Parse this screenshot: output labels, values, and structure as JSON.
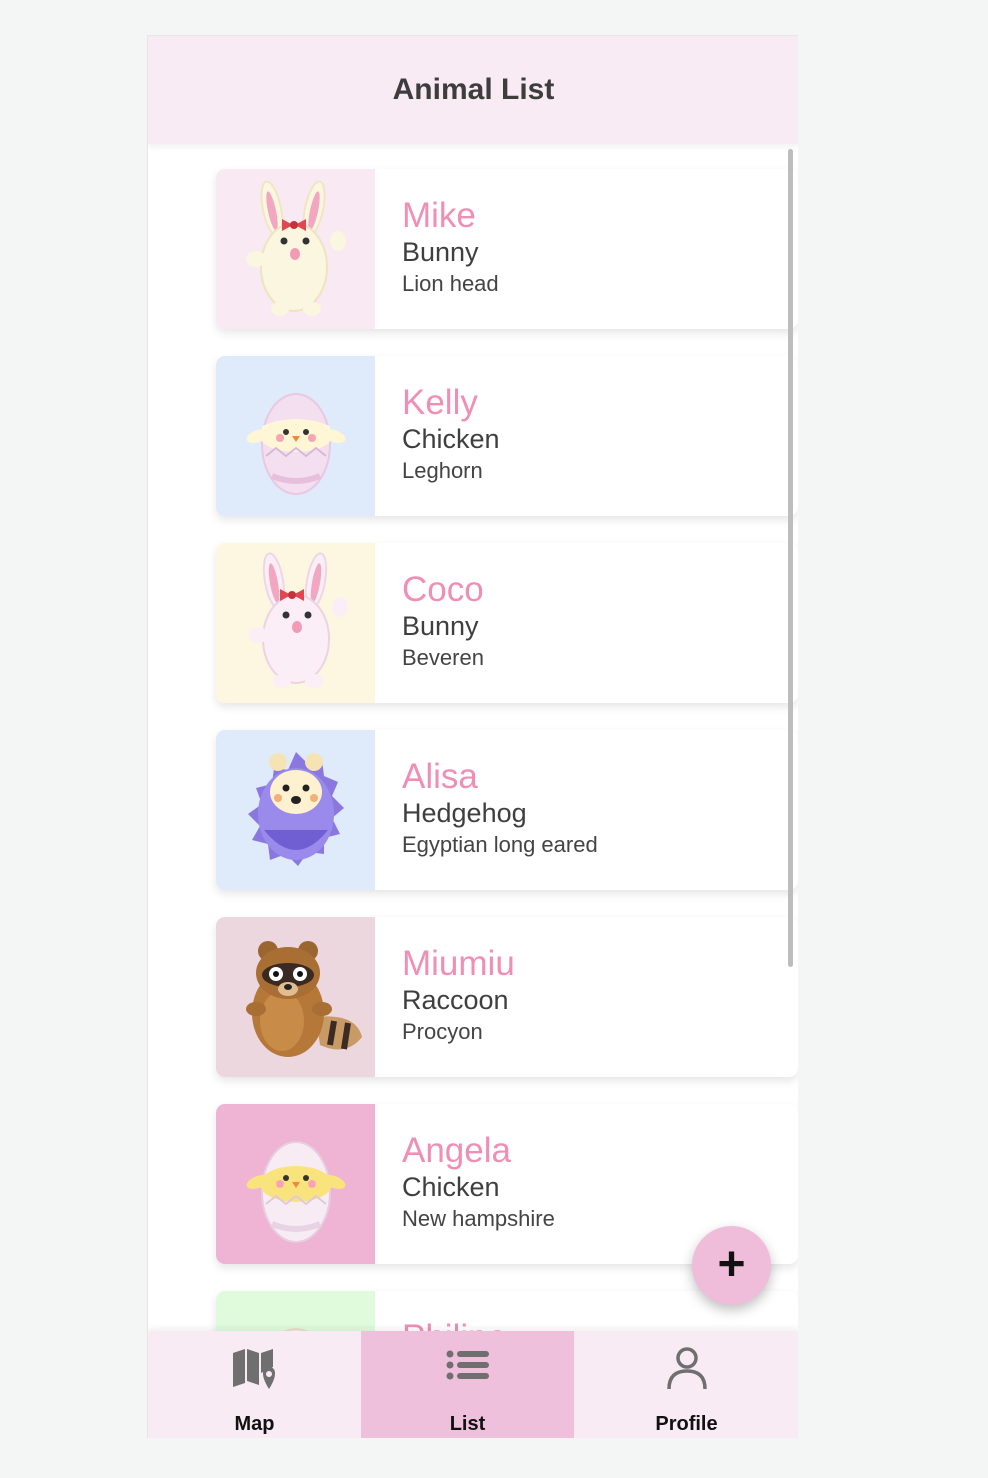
{
  "header": {
    "title": "Animal List"
  },
  "animals": [
    {
      "name": "Mike",
      "species": "Bunny",
      "breed": "Lion head",
      "bg": "#f8e9f3",
      "icon": "bunny-icon"
    },
    {
      "name": "Kelly",
      "species": "Chicken",
      "breed": "Leghorn",
      "bg": "#dfeafb",
      "icon": "chick-in-egg-icon"
    },
    {
      "name": "Coco",
      "species": "Bunny",
      "breed": "Beveren",
      "bg": "#fdf7e1",
      "icon": "bunny-icon"
    },
    {
      "name": "Alisa",
      "species": "Hedgehog",
      "breed": "Egyptian long eared",
      "bg": "#dfeafb",
      "icon": "hedgehog-icon"
    },
    {
      "name": "Miumiu",
      "species": "Raccoon",
      "breed": "Procyon",
      "bg": "#ecd7df",
      "icon": "raccoon-icon"
    },
    {
      "name": "Angela",
      "species": "Chicken",
      "breed": "New hampshire",
      "bg": "#efb3d3",
      "icon": "chick-in-egg-icon"
    },
    {
      "name": "Philipo",
      "species": "",
      "breed": "",
      "bg": "#dffbdc",
      "icon": "chick-in-egg-icon"
    }
  ],
  "fab": {
    "label": "+",
    "icon": "plus-icon"
  },
  "nav": {
    "items": [
      {
        "label": "Map",
        "icon": "map-icon",
        "active": false
      },
      {
        "label": "List",
        "icon": "list-icon",
        "active": true
      },
      {
        "label": "Profile",
        "icon": "profile-icon",
        "active": false
      }
    ]
  },
  "colors": {
    "accent_pink": "#ef8fb5",
    "appbar_bg": "#f8ebf3",
    "nav_active_bg": "#efc0db",
    "fab_bg": "#efbcd9"
  }
}
